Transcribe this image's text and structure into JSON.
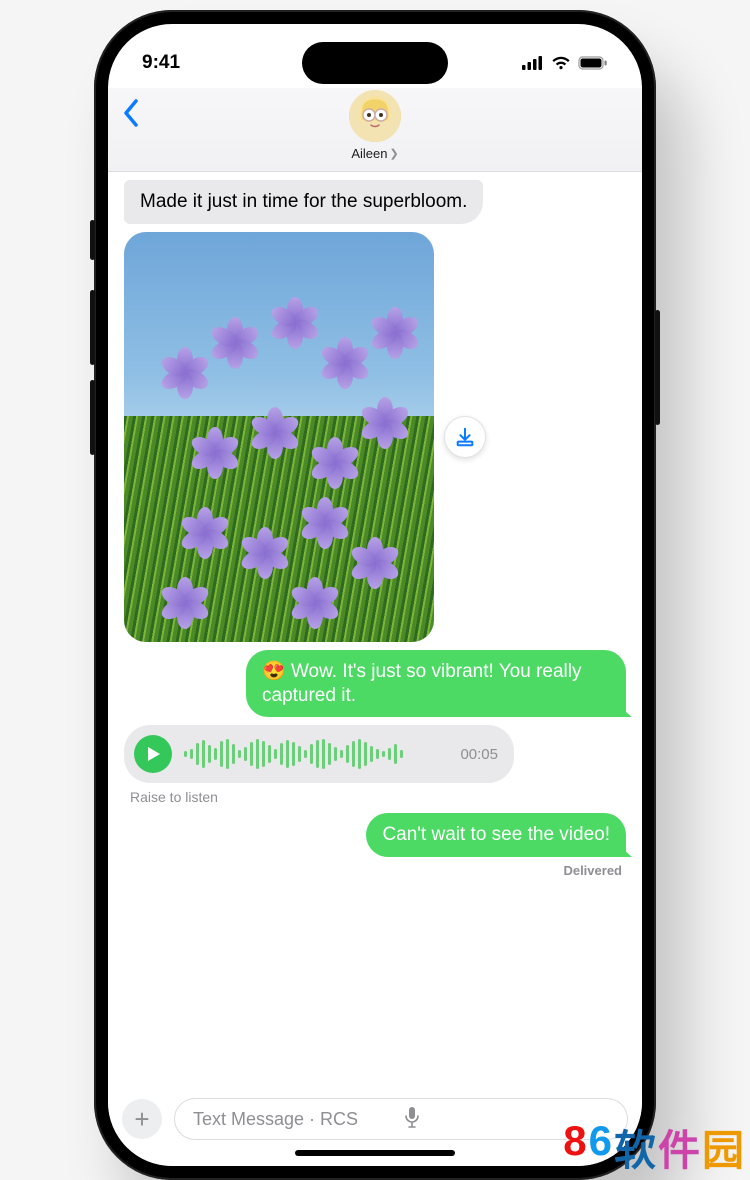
{
  "status": {
    "time": "9:41"
  },
  "header": {
    "contact_name": "Aileen"
  },
  "messages": {
    "in1": "Made it just in time for the superbloom.",
    "out1_emoji": "😍",
    "out1": " Wow. It's just so vibrant! You really captured it.",
    "audio_duration": "00:05",
    "audio_hint": "Raise to listen",
    "out2": "Can't wait to see the video!",
    "delivered": "Delivered"
  },
  "input": {
    "placeholder": "Text Message · RCS"
  },
  "watermark": {
    "d1": "8",
    "d2": "6",
    "t1": "软",
    "t2": "件",
    "t3": "园"
  },
  "colors": {
    "accent_green": "#4cd964",
    "ios_blue": "#0a7aff"
  }
}
